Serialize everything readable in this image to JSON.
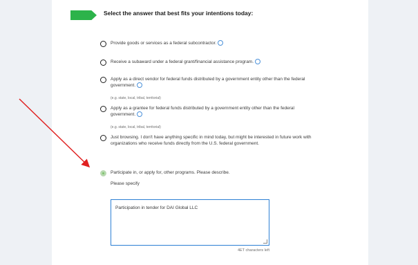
{
  "question": "Select the answer that best fits your intentions today:",
  "options": [
    {
      "label": "Provide goods or services as a federal subcontractor.",
      "checked": false,
      "info": true
    },
    {
      "label": "Receive a subaward under a federal grant/financial assistance program.",
      "checked": false,
      "info": true
    },
    {
      "label": "Apply as a direct vendor for federal funds distributed by a government entity other than the federal government.",
      "checked": false,
      "info": true,
      "hint": "(e.g. state, local, tribal, territorial)"
    },
    {
      "label": "Apply as a grantee for federal funds distributed by a government entity other than the federal government.",
      "checked": false,
      "info": true,
      "hint": "(e.g. state, local, tribal, territorial)"
    },
    {
      "label": "Just browsing. I don't have anything specific in mind today, but might be interested in future work with organizations who receive funds directly from the U.S. federal government.",
      "checked": false,
      "info": false
    },
    {
      "label": "Participate in, or apply for, other programs. Please describe.",
      "checked": true,
      "info": false
    }
  ],
  "specify": {
    "label": "Please specify",
    "value": "Participation in tender for DAI Global LLC",
    "counter": "4ET characters left"
  },
  "colors": {
    "step_indicator": "#2cb34a",
    "textarea_border": "#2b7fd4",
    "annotation_arrow": "#e02020",
    "selected_radio": "#7fc36f"
  }
}
